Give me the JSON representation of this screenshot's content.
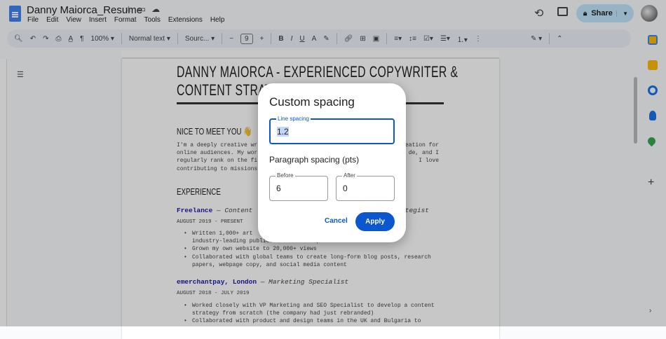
{
  "app": {
    "title": "Danny Maiorca_Resume",
    "menu": [
      "File",
      "Edit",
      "View",
      "Insert",
      "Format",
      "Tools",
      "Extensions",
      "Help"
    ],
    "share_label": "Share"
  },
  "toolbar": {
    "zoom": "100%",
    "style": "Normal text",
    "font": "Sourc...",
    "font_size": "9",
    "bold": "B",
    "italic": "I",
    "underline": "U"
  },
  "document": {
    "heading_line1": "DANNY MAIORCA - EXPERIENCED COPYWRITER &",
    "heading_line2": "CONTENT STRAT",
    "intro_heading": "NICE TO MEET YOU 👋",
    "intro_lines": [
      {
        "left": "I'm a deeply creative wr",
        "right": "eation for"
      },
      {
        "left": "online audiences. My wor",
        "right": "de, and I"
      },
      {
        "left": "regularly rank on the fi",
        "right": "I love"
      },
      {
        "left": "contributing to missions",
        "right": ""
      }
    ],
    "experience_heading": "EXPERIENCE",
    "jobs": [
      {
        "company": "Freelance",
        "role_left": " — Content",
        "role_right": "tegist",
        "dates": "AUGUST 2019 - PRESENT",
        "bullets": [
          "Written 1,000+ art",
          "industry-leading publications and companies",
          "Grown my own website to 20,000+ views",
          "Collaborated with global teams to create long-form blog posts, research",
          "papers, webpage copy, and social media content"
        ]
      },
      {
        "company": "emerchantpay, London",
        "role_left": " — Marketing Specialist",
        "role_right": "",
        "dates": "AUGUST 2018 - JULY 2019",
        "bullets": [
          "Worked closely with VP Marketing and SEO Specialist to develop a content",
          "strategy from scratch (the company had just rebranded)",
          "Collaborated with product and design teams in the UK and Bulgaria to"
        ]
      }
    ]
  },
  "dialog": {
    "title": "Custom spacing",
    "line_spacing_label": "Line spacing",
    "line_spacing_value": "1.2",
    "paragraph_label": "Paragraph spacing (pts)",
    "before_label": "Before",
    "before_value": "6",
    "after_label": "After",
    "after_value": "0",
    "cancel": "Cancel",
    "apply": "Apply"
  },
  "colors": {
    "accent": "#0b57d0",
    "share_bg": "#c2e7ff"
  }
}
